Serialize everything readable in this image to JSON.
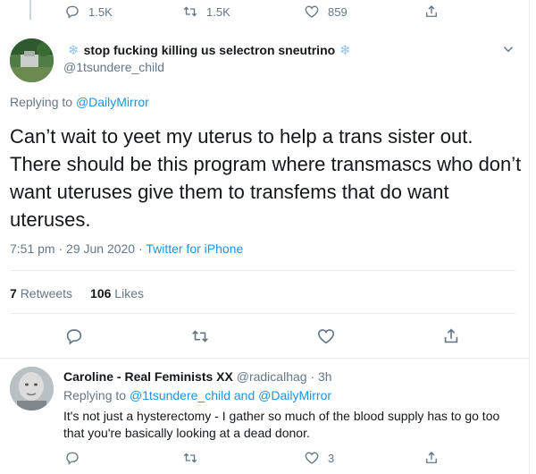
{
  "prev_tweet": {
    "reply_count": "1.5K",
    "retweet_count": "1.5K",
    "like_count": "859"
  },
  "main_tweet": {
    "display_name": "stop fucking killing us selectron sneutrino",
    "handle": "@1tsundere_child",
    "replying_prefix": "Replying to",
    "replying_to": "@DailyMirror",
    "text": "Can’t wait to yeet my uterus to help a trans sister out. There should be this program where transmascs who don’t want uteruses give them to transfems that do want uteruses.",
    "time": "7:51 pm · 29 Jun 2020",
    "source_sep": "·",
    "source": "Twitter for iPhone",
    "retweets_count": "7",
    "retweets_label": "Retweets",
    "likes_count": "106",
    "likes_label": "Likes"
  },
  "reply": {
    "display_name": "Caroline - Real Feminists XX",
    "handle": "@radicalhag",
    "time": "· 3h",
    "replying_prefix": "Replying to",
    "replying_to_1": "@1tsundere_child",
    "replying_and": "and",
    "replying_to_2": "@DailyMirror",
    "text": "It's not just a hysterectomy - I gather so much of the blood supply has to go too that you're basically looking at a dead donor.",
    "like_count": "3"
  },
  "colors": {
    "accent": "#1b95e0",
    "muted": "#657786",
    "text": "#14171a",
    "divider": "#e6ecf0"
  },
  "icons": [
    "reply-icon",
    "retweet-icon",
    "like-icon",
    "share-icon",
    "chevron-down-icon",
    "snowflake-icon"
  ]
}
